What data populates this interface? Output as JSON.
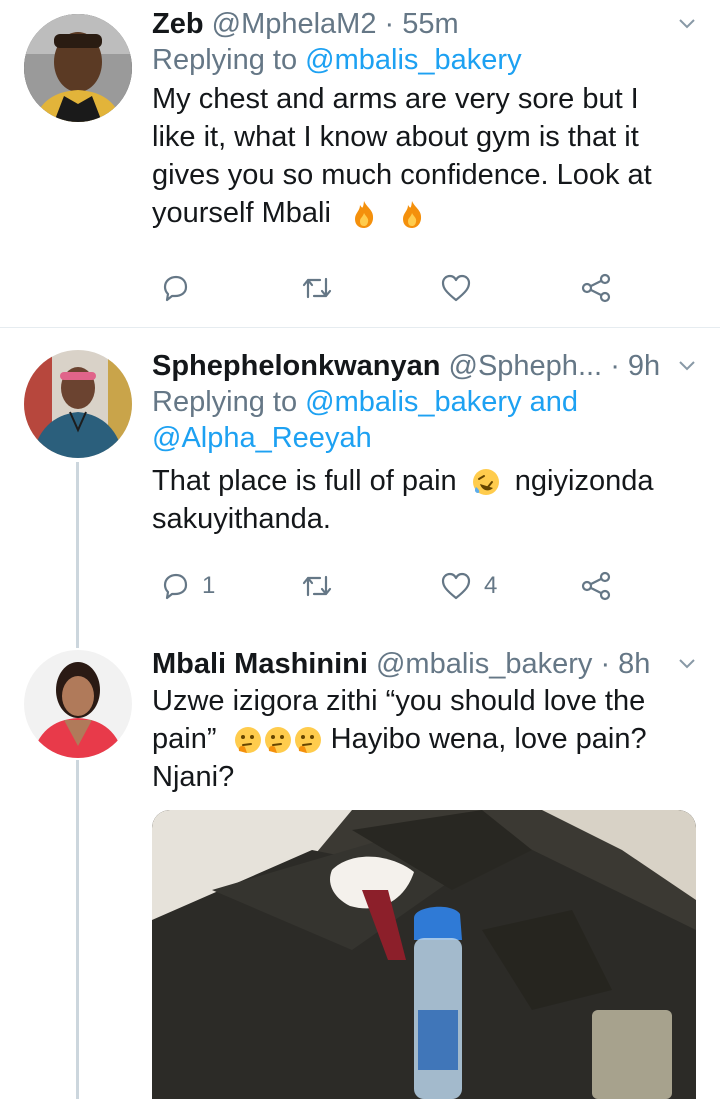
{
  "tweets": [
    {
      "name": "Zeb",
      "handle": "@MphelaM2",
      "time": "· 55m",
      "replying_prefix": "Replying to",
      "replying_to": "@mbalis_bakery",
      "replying_and": "",
      "replying_to2": "",
      "lines": [
        "My chest and arms are very sore but I",
        "like it, what I know about gym is that it",
        "gives you so much confidence. Look at",
        "yourself Mbali"
      ],
      "emoji": [
        "fire-emoji",
        "fire-emoji"
      ],
      "reply_count": "",
      "like_count": ""
    },
    {
      "name": "Sphephelonkwanyan",
      "handle": "@Spheph...",
      "time": "· 9h",
      "replying_prefix": "Replying to",
      "replying_to": "@mbalis_bakery",
      "replying_and": "and",
      "replying_to2": "@Alpha_Reeyah",
      "line1_a": "That place is full of pain",
      "line1_b": "ngiyizonda",
      "line2": "sakuyithanda.",
      "reply_count": "1",
      "like_count": "4"
    },
    {
      "name": "Mbali Mashinini",
      "handle": "@mbalis_bakery",
      "time": "· 8h",
      "line1": "Uzwe izigora zithi “you should love the",
      "line2_a": "pain”",
      "line2_b": "Hayibo wena, love pain?",
      "line3": "Njani?"
    }
  ],
  "icons": {
    "reply": "reply-icon",
    "retweet": "retweet-icon",
    "like": "heart-icon",
    "share": "share-icon",
    "more": "chevron-down-icon"
  },
  "colors": {
    "link": "#1da1f2",
    "secondary": "#657786",
    "icon": "#657786",
    "fire": "#f4900c",
    "thinking": "#ffcc4d"
  }
}
